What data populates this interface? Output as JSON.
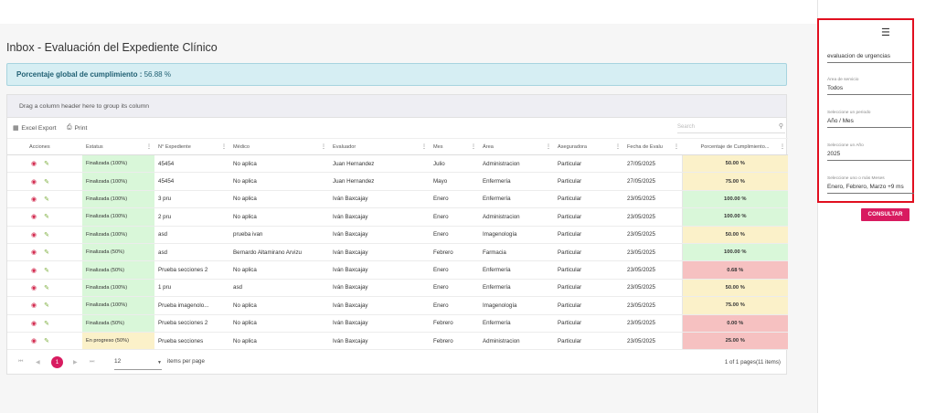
{
  "page": {
    "title": "Inbox - Evaluación del Expediente Clínico",
    "global_label": "Porcentaje global de cumplimiento :",
    "global_value": "56.88 %"
  },
  "grid": {
    "group_hint": "Drag a column header here to group its column",
    "export_label": "Excel Export",
    "print_label": "Print",
    "search_placeholder": "Search",
    "columns": [
      "Acciones",
      "Estatus",
      "N° Expediente",
      "Médico",
      "Evaluador",
      "Mes",
      "Área",
      "Aseguradora",
      "Fecha de Evalu",
      "Porcentaje de Cumplimiento..."
    ],
    "rows": [
      {
        "estatus": "Finalizada (100%)",
        "status_color": "green",
        "expediente": "45454",
        "medico": "No aplica",
        "evaluador": "Juan Hernandez",
        "mes": "Julio",
        "area": "Administracion",
        "aseguradora": "Particular",
        "fecha": "27/05/2025",
        "porcentaje": "50.00 %",
        "pct_color": "yellow"
      },
      {
        "estatus": "Finalizada (100%)",
        "status_color": "green",
        "expediente": "45454",
        "medico": "No aplica",
        "evaluador": "Juan Hernandez",
        "mes": "Mayo",
        "area": "Enfermería",
        "aseguradora": "Particular",
        "fecha": "27/05/2025",
        "porcentaje": "75.00 %",
        "pct_color": "yellow"
      },
      {
        "estatus": "Finalizada (100%)",
        "status_color": "green",
        "expediente": "3 pru",
        "medico": "No aplica",
        "evaluador": "Iván Baxcajay",
        "mes": "Enero",
        "area": "Enfermería",
        "aseguradora": "Particular",
        "fecha": "23/05/2025",
        "porcentaje": "100.00 %",
        "pct_color": "green"
      },
      {
        "estatus": "Finalizada (100%)",
        "status_color": "green",
        "expediente": "2 pru",
        "medico": "No aplica",
        "evaluador": "Iván Baxcajay",
        "mes": "Enero",
        "area": "Administracion",
        "aseguradora": "Particular",
        "fecha": "23/05/2025",
        "porcentaje": "100.00 %",
        "pct_color": "green"
      },
      {
        "estatus": "Finalizada (100%)",
        "status_color": "green",
        "expediente": "asd",
        "medico": "prueba ivan",
        "evaluador": "Iván Baxcajay",
        "mes": "Enero",
        "area": "Imagenología",
        "aseguradora": "Particular",
        "fecha": "23/05/2025",
        "porcentaje": "50.00 %",
        "pct_color": "yellow"
      },
      {
        "estatus": "Finalizada (50%)",
        "status_color": "green",
        "expediente": "asd",
        "medico": "Bernardo Altamirano Arvizu",
        "evaluador": "Iván Baxcajay",
        "mes": "Febrero",
        "area": "Farmacia",
        "aseguradora": "Particular",
        "fecha": "23/05/2025",
        "porcentaje": "100.00 %",
        "pct_color": "green"
      },
      {
        "estatus": "Finalizada (50%)",
        "status_color": "green",
        "expediente": "Prueba secciones 2",
        "medico": "No aplica",
        "evaluador": "Iván Baxcajay",
        "mes": "Enero",
        "area": "Enfermería",
        "aseguradora": "Particular",
        "fecha": "23/05/2025",
        "porcentaje": "0.68 %",
        "pct_color": "red"
      },
      {
        "estatus": "Finalizada (100%)",
        "status_color": "green",
        "expediente": "1 pru",
        "medico": "asd",
        "evaluador": "Iván Baxcajay",
        "mes": "Enero",
        "area": "Enfermería",
        "aseguradora": "Particular",
        "fecha": "23/05/2025",
        "porcentaje": "50.00 %",
        "pct_color": "yellow"
      },
      {
        "estatus": "Finalizada (100%)",
        "status_color": "green",
        "expediente": "Prueba imagenolo...",
        "medico": "No aplica",
        "evaluador": "Iván Baxcajay",
        "mes": "Enero",
        "area": "Imagenología",
        "aseguradora": "Particular",
        "fecha": "23/05/2025",
        "porcentaje": "75.00 %",
        "pct_color": "yellow"
      },
      {
        "estatus": "Finalizada (50%)",
        "status_color": "green",
        "expediente": "Prueba secciones 2",
        "medico": "No aplica",
        "evaluador": "Iván Baxcajay",
        "mes": "Febrero",
        "area": "Enfermería",
        "aseguradora": "Particular",
        "fecha": "23/05/2025",
        "porcentaje": "0.00 %",
        "pct_color": "red"
      },
      {
        "estatus": "En progreso (50%)",
        "status_color": "yellow",
        "expediente": "Prueba secciones",
        "medico": "No aplica",
        "evaluador": "Iván Baxcajay",
        "mes": "Febrero",
        "area": "Administracion",
        "aseguradora": "Particular",
        "fecha": "23/05/2025",
        "porcentaje": "25.00 %",
        "pct_color": "red"
      }
    ]
  },
  "pager": {
    "current_page": "1",
    "page_size": "12",
    "items_per_page_label": "items per page",
    "info": "1 of 1 pages(11 items)"
  },
  "panel": {
    "search_value": "evaluacion de urgencias",
    "area_label": "Área de servicio",
    "area_value": "Todos",
    "period_label": "Seleccione un periodo",
    "period_value": "Año / Mes",
    "year_label": "Seleccione un Año",
    "year_value": "2025",
    "months_label": "Seleccione uno o más Meses",
    "months_value": "Enero, Febrero, Marzo  +9 ms",
    "consult_label": "CONSULTAR"
  },
  "colors": {
    "accent": "#d81b60",
    "highlight": "#e10f1f",
    "ok_bg": "#d9f7d9",
    "warn_bg": "#fbf1c9",
    "bad_bg": "#f6c1c1"
  }
}
